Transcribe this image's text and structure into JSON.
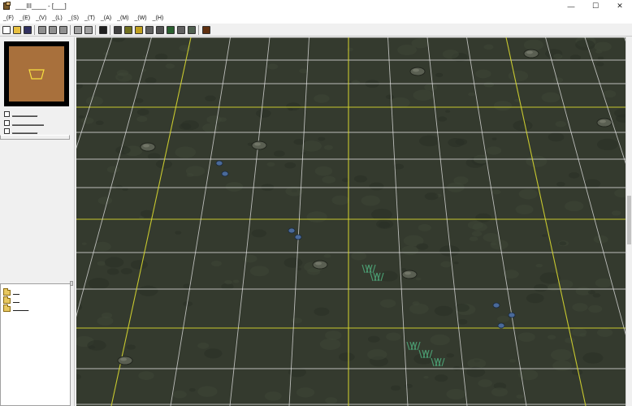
{
  "window": {
    "title": "___III____ - [___]",
    "minimize": "—",
    "maximize": "☐",
    "close": "✕"
  },
  "menu": {
    "items": [
      "_(F)",
      "_(E)",
      "_(V)",
      "_(L)",
      "_(S)",
      "_(T)",
      "_(A)",
      "_(M)",
      "_(W)",
      "_(H)"
    ]
  },
  "toolbar": {
    "buttons": [
      {
        "name": "new-icon",
        "color": "#ffffff"
      },
      {
        "name": "open-icon",
        "color": "#e8c040"
      },
      {
        "name": "save-icon",
        "color": "#303060"
      },
      {
        "name": "sep"
      },
      {
        "name": "cut-icon",
        "color": "#909090"
      },
      {
        "name": "copy-icon",
        "color": "#909090"
      },
      {
        "name": "paste-icon",
        "color": "#909090"
      },
      {
        "name": "sep"
      },
      {
        "name": "undo-icon",
        "color": "#a0a0a0"
      },
      {
        "name": "redo-icon",
        "color": "#a0a0a0"
      },
      {
        "name": "sep"
      },
      {
        "name": "select-region-icon",
        "color": "#202020"
      },
      {
        "name": "sep"
      },
      {
        "name": "terrain-palette-icon",
        "color": "#404040"
      },
      {
        "name": "doodad-palette-icon",
        "color": "#707020"
      },
      {
        "name": "sound-palette-icon",
        "color": "#c0a020"
      },
      {
        "name": "unit-palette-icon",
        "color": "#606060"
      },
      {
        "name": "camera-palette-icon",
        "color": "#505050"
      },
      {
        "name": "region-palette-icon",
        "color": "#2a6030"
      },
      {
        "name": "object-editor-icon",
        "color": "#606060"
      },
      {
        "name": "trigger-editor-icon",
        "color": "#506050"
      },
      {
        "name": "sep"
      },
      {
        "name": "test-map-icon",
        "color": "#603010"
      }
    ]
  },
  "left_panel": {
    "options": [
      {
        "label": "________"
      },
      {
        "label": "__________"
      },
      {
        "label": "________"
      }
    ],
    "tree": [
      {
        "label": "__"
      },
      {
        "label": "__"
      },
      {
        "label": "_____"
      }
    ]
  },
  "viewport": {
    "ground_color": "#343a2e",
    "grid_color": "#e8e8e8",
    "major_grid_color": "#d8d830"
  }
}
